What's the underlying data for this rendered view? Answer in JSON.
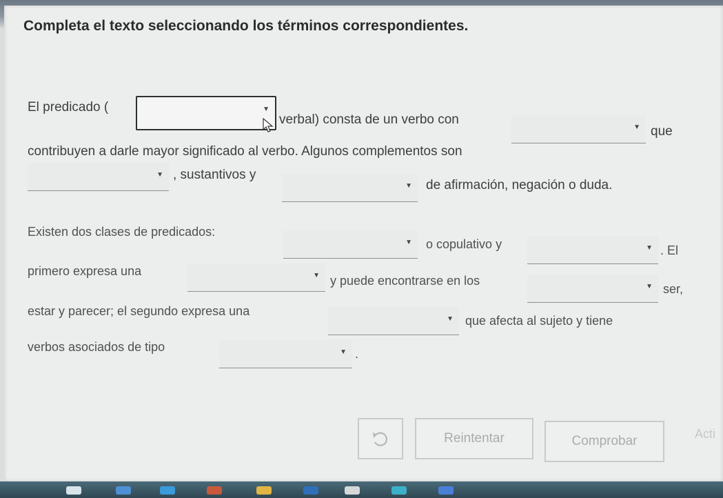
{
  "instructions": "Completa el texto seleccionando los términos correspondientes.",
  "text": {
    "p1_a": "El predicado (",
    "p1_b": "verbal) consta de un verbo con",
    "p1_c": "que",
    "p1_d": "contribuyen a darle mayor significado al verbo. Algunos complementos son",
    "p1_e": ", sustantivos y",
    "p1_f": "de afirmación, negación o duda.",
    "p2_a": "Existen dos clases de predicados:",
    "p2_b": "o copulativo y",
    "p2_c": ". El",
    "p2_d": "primero expresa una",
    "p2_e": "y puede encontrarse en los",
    "p2_f": "ser,",
    "p2_g": "estar y parecer; el segundo expresa una",
    "p2_h": "que afecta al sujeto y tiene",
    "p2_i": "verbos asociados de tipo",
    "p2_j": "."
  },
  "dropdowns": [
    {
      "id": 1,
      "value": ""
    },
    {
      "id": 2,
      "value": ""
    },
    {
      "id": 3,
      "value": ""
    },
    {
      "id": 4,
      "value": ""
    },
    {
      "id": 5,
      "value": ""
    },
    {
      "id": 6,
      "value": ""
    },
    {
      "id": 7,
      "value": ""
    },
    {
      "id": 8,
      "value": ""
    },
    {
      "id": 9,
      "value": ""
    },
    {
      "id": 10,
      "value": ""
    }
  ],
  "buttons": {
    "reset_icon": "undo-icon",
    "reintentar": "Reintentar",
    "comprobar": "Comprobar"
  },
  "watermark": "Acti"
}
